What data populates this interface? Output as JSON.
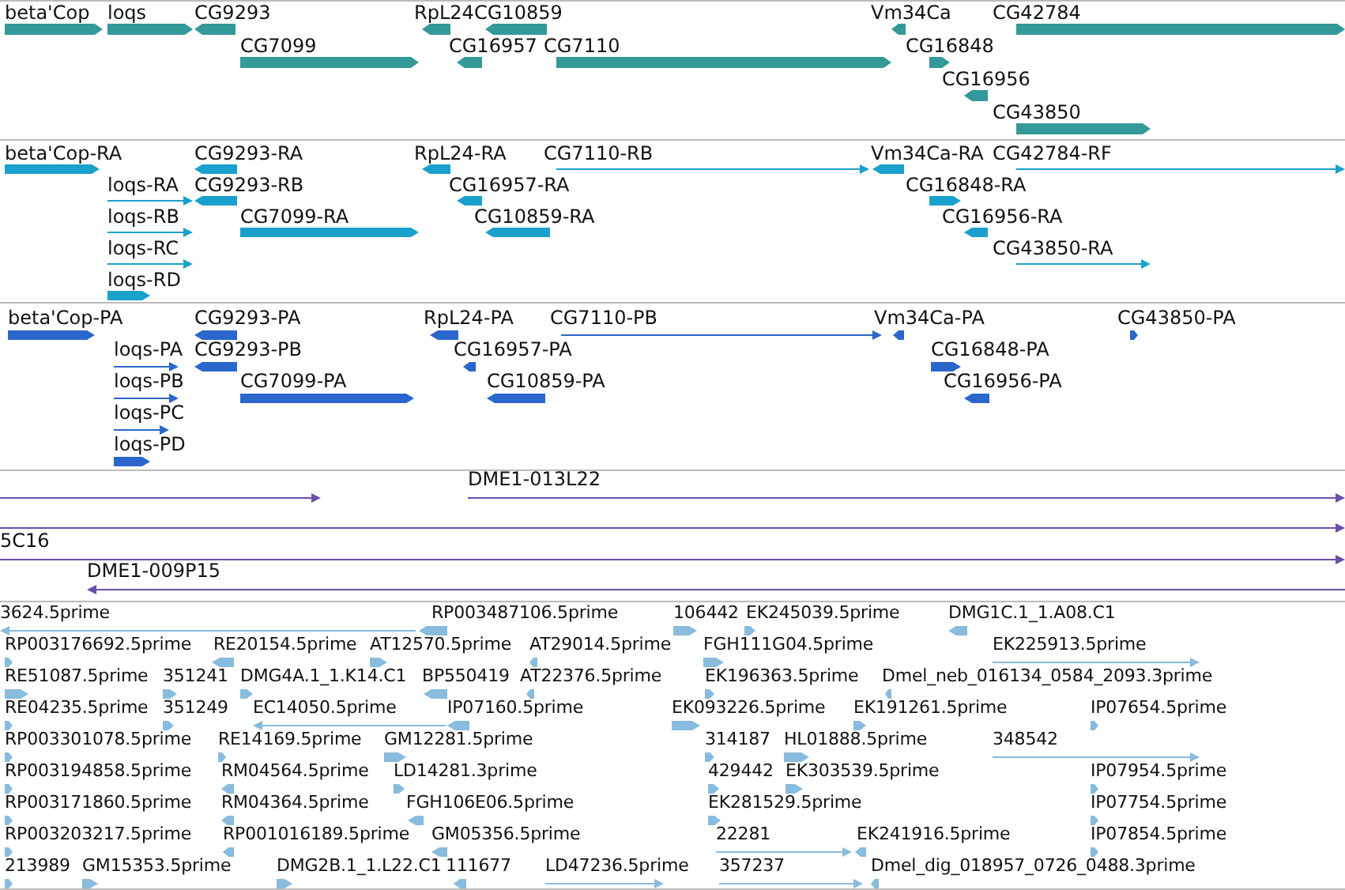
{
  "tracks": [
    {
      "kind": "genes",
      "features": [
        {
          "label": "beta'Cop",
          "reverse": false
        },
        {
          "label": "loqs",
          "reverse": false
        },
        {
          "label": "CG9293",
          "reverse": true
        },
        {
          "label": "RpL24",
          "reverse": true
        },
        {
          "label": "CG10859",
          "reverse": true
        },
        {
          "label": "Vm34Ca",
          "reverse": true
        },
        {
          "label": "CG42784",
          "reverse": false
        },
        {
          "label": "CG7099",
          "reverse": false
        },
        {
          "label": "CG16957",
          "reverse": true
        },
        {
          "label": "CG7110",
          "reverse": false
        },
        {
          "label": "CG16848",
          "reverse": false
        },
        {
          "label": "CG16956",
          "reverse": true
        },
        {
          "label": "CG43850",
          "reverse": false
        }
      ]
    },
    {
      "kind": "transcripts",
      "features": [
        {
          "label": "beta'Cop-RA",
          "reverse": false
        },
        {
          "label": "CG9293-RA",
          "reverse": true
        },
        {
          "label": "RpL24-RA",
          "reverse": true
        },
        {
          "label": "CG7110-RB",
          "reverse": false
        },
        {
          "label": "Vm34Ca-RA",
          "reverse": true
        },
        {
          "label": "CG42784-RF",
          "reverse": false
        },
        {
          "label": "loqs-RA",
          "reverse": false
        },
        {
          "label": "CG9293-RB",
          "reverse": true
        },
        {
          "label": "CG16957-RA",
          "reverse": true
        },
        {
          "label": "CG16848-RA",
          "reverse": false
        },
        {
          "label": "loqs-RB",
          "reverse": false
        },
        {
          "label": "CG7099-RA",
          "reverse": false
        },
        {
          "label": "CG10859-RA",
          "reverse": true
        },
        {
          "label": "CG16956-RA",
          "reverse": true
        },
        {
          "label": "loqs-RC",
          "reverse": false
        },
        {
          "label": "CG43850-RA",
          "reverse": false
        },
        {
          "label": "loqs-RD",
          "reverse": false
        }
      ]
    },
    {
      "kind": "proteins",
      "features": [
        {
          "label": "beta'Cop-PA",
          "reverse": false
        },
        {
          "label": "CG9293-PA",
          "reverse": true
        },
        {
          "label": "RpL24-PA",
          "reverse": true
        },
        {
          "label": "CG7110-PB",
          "reverse": false
        },
        {
          "label": "Vm34Ca-PA",
          "reverse": true
        },
        {
          "label": "CG43850-PA",
          "reverse": false
        },
        {
          "label": "loqs-PA",
          "reverse": false
        },
        {
          "label": "CG9293-PB",
          "reverse": true
        },
        {
          "label": "CG16957-PA",
          "reverse": true
        },
        {
          "label": "CG16848-PA",
          "reverse": false
        },
        {
          "label": "loqs-PB",
          "reverse": false
        },
        {
          "label": "CG7099-PA",
          "reverse": false
        },
        {
          "label": "CG10859-PA",
          "reverse": true
        },
        {
          "label": "CG16956-PA",
          "reverse": true
        },
        {
          "label": "loqs-PC",
          "reverse": false
        },
        {
          "label": "loqs-PD",
          "reverse": false
        }
      ]
    },
    {
      "kind": "clones",
      "features": [
        {
          "reverse": false
        },
        {
          "label": "DME1-013L22",
          "reverse": false
        },
        {
          "reverse": false
        },
        {
          "label": "5C16",
          "reverse": false
        },
        {
          "label": "DME1-009P15",
          "reverse": true
        }
      ]
    },
    {
      "kind": "ests",
      "features": [
        {
          "label": "3624.5prime",
          "reverse": true
        },
        {
          "label": "RP003487106.5prime",
          "reverse": true
        },
        {
          "label": "106442",
          "reverse": false
        },
        {
          "label": "EK245039.5prime",
          "reverse": false
        },
        {
          "label": "DMG1C.1_1.A08.C1",
          "reverse": true
        },
        {
          "label": "RP003176692.5prime",
          "reverse": false
        },
        {
          "label": "RE20154.5prime",
          "reverse": true
        },
        {
          "label": "AT12570.5prime",
          "reverse": false
        },
        {
          "label": "AT29014.5prime",
          "reverse": true
        },
        {
          "label": "FGH111G04.5prime",
          "reverse": false
        },
        {
          "label": "EK225913.5prime",
          "reverse": false
        },
        {
          "label": "RE51087.5prime",
          "reverse": false
        },
        {
          "label": "351241",
          "reverse": false
        },
        {
          "label": "DMG4A.1_1.K14.C1",
          "reverse": false
        },
        {
          "label": "BP550419",
          "reverse": true
        },
        {
          "label": "AT22376.5prime",
          "reverse": true
        },
        {
          "label": "EK196363.5prime",
          "reverse": false
        },
        {
          "label": "Dmel_neb_016134_0584_2093.3prime",
          "reverse": true
        },
        {
          "label": "RE04235.5prime",
          "reverse": false
        },
        {
          "label": "351249",
          "reverse": false
        },
        {
          "label": "EC14050.5prime",
          "reverse": true
        },
        {
          "label": "IP07160.5prime",
          "reverse": true
        },
        {
          "label": "EK093226.5prime",
          "reverse": false
        },
        {
          "label": "EK191261.5prime",
          "reverse": false
        },
        {
          "label": "IP07654.5prime",
          "reverse": false
        },
        {
          "label": "RP003301078.5prime",
          "reverse": false
        },
        {
          "label": "RE14169.5prime",
          "reverse": false
        },
        {
          "label": "GM12281.5prime",
          "reverse": false
        },
        {
          "label": "314187",
          "reverse": false
        },
        {
          "label": "HL01888.5prime",
          "reverse": false
        },
        {
          "label": "348542",
          "reverse": false
        },
        {
          "label": "RP003194858.5prime",
          "reverse": false
        },
        {
          "label": "RM04564.5prime",
          "reverse": true
        },
        {
          "label": "LD14281.3prime",
          "reverse": false
        },
        {
          "label": "429442",
          "reverse": false
        },
        {
          "label": "EK303539.5prime",
          "reverse": false
        },
        {
          "label": "IP07954.5prime",
          "reverse": false
        },
        {
          "label": "RP003171860.5prime",
          "reverse": false
        },
        {
          "label": "RM04364.5prime",
          "reverse": true
        },
        {
          "label": "FGH106E06.5prime",
          "reverse": true
        },
        {
          "label": "EK281529.5prime",
          "reverse": false
        },
        {
          "label": "IP07754.5prime",
          "reverse": false
        },
        {
          "label": "RP003203217.5prime",
          "reverse": false
        },
        {
          "label": "RP001016189.5prime",
          "reverse": true
        },
        {
          "label": "GM05356.5prime",
          "reverse": true
        },
        {
          "label": "22281",
          "reverse": false
        },
        {
          "label": "EK241916.5prime",
          "reverse": true
        },
        {
          "label": "IP07854.5prime",
          "reverse": false
        },
        {
          "label": "213989",
          "reverse": false
        },
        {
          "label": "GM15353.5prime",
          "reverse": false
        },
        {
          "label": "DMG2B.1_1.L22.C1",
          "reverse": false
        },
        {
          "label": "111677",
          "reverse": true
        },
        {
          "label": "LD47236.5prime",
          "reverse": false
        },
        {
          "label": "357237",
          "reverse": false
        },
        {
          "label": "Dmel_dig_018957_0726_0488.3prime",
          "reverse": true
        }
      ]
    }
  ]
}
